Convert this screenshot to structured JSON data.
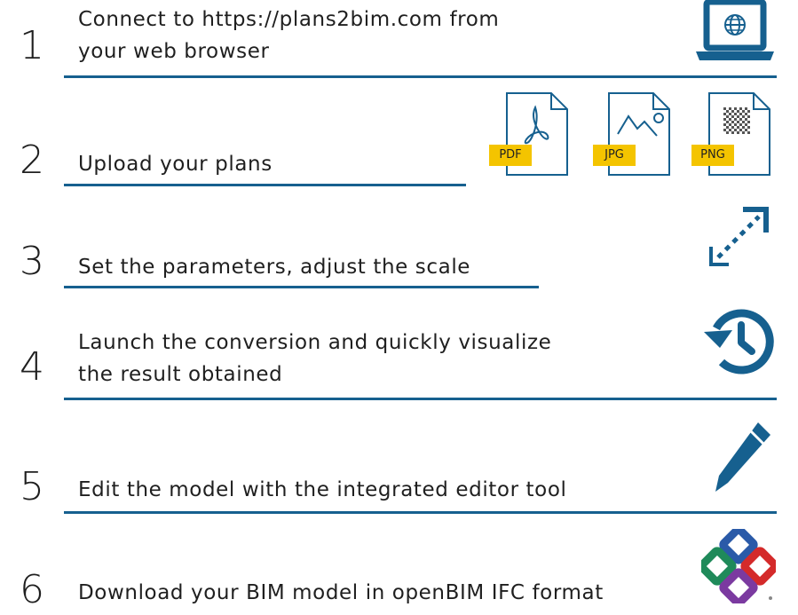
{
  "colors": {
    "accent_blue": "#16608f",
    "tag_yellow": "#f4c400",
    "text": "#1f1f1f"
  },
  "steps": [
    {
      "number": "1",
      "text_lines": [
        "Connect to https://plans2bim.com from",
        "your web browser"
      ],
      "icon": "laptop-globe-icon"
    },
    {
      "number": "2",
      "text_lines": [
        "Upload your plans"
      ],
      "icon": "file-type-icons"
    },
    {
      "number": "3",
      "text_lines": [
        "Set the parameters, adjust the scale"
      ],
      "icon": "resize-arrows-icon"
    },
    {
      "number": "4",
      "text_lines": [
        "Launch the conversion and quickly visualize",
        "the result obtained"
      ],
      "icon": "history-clock-icon"
    },
    {
      "number": "5",
      "text_lines": [
        "Edit the model with the integrated editor tool"
      ],
      "icon": "pencil-icon"
    },
    {
      "number": "6",
      "text_lines": [
        "Download your BIM model in openBIM IFC format"
      ],
      "icon": "ifc-logo-icon"
    }
  ],
  "file_tags": [
    "PDF",
    "JPG",
    "PNG"
  ]
}
